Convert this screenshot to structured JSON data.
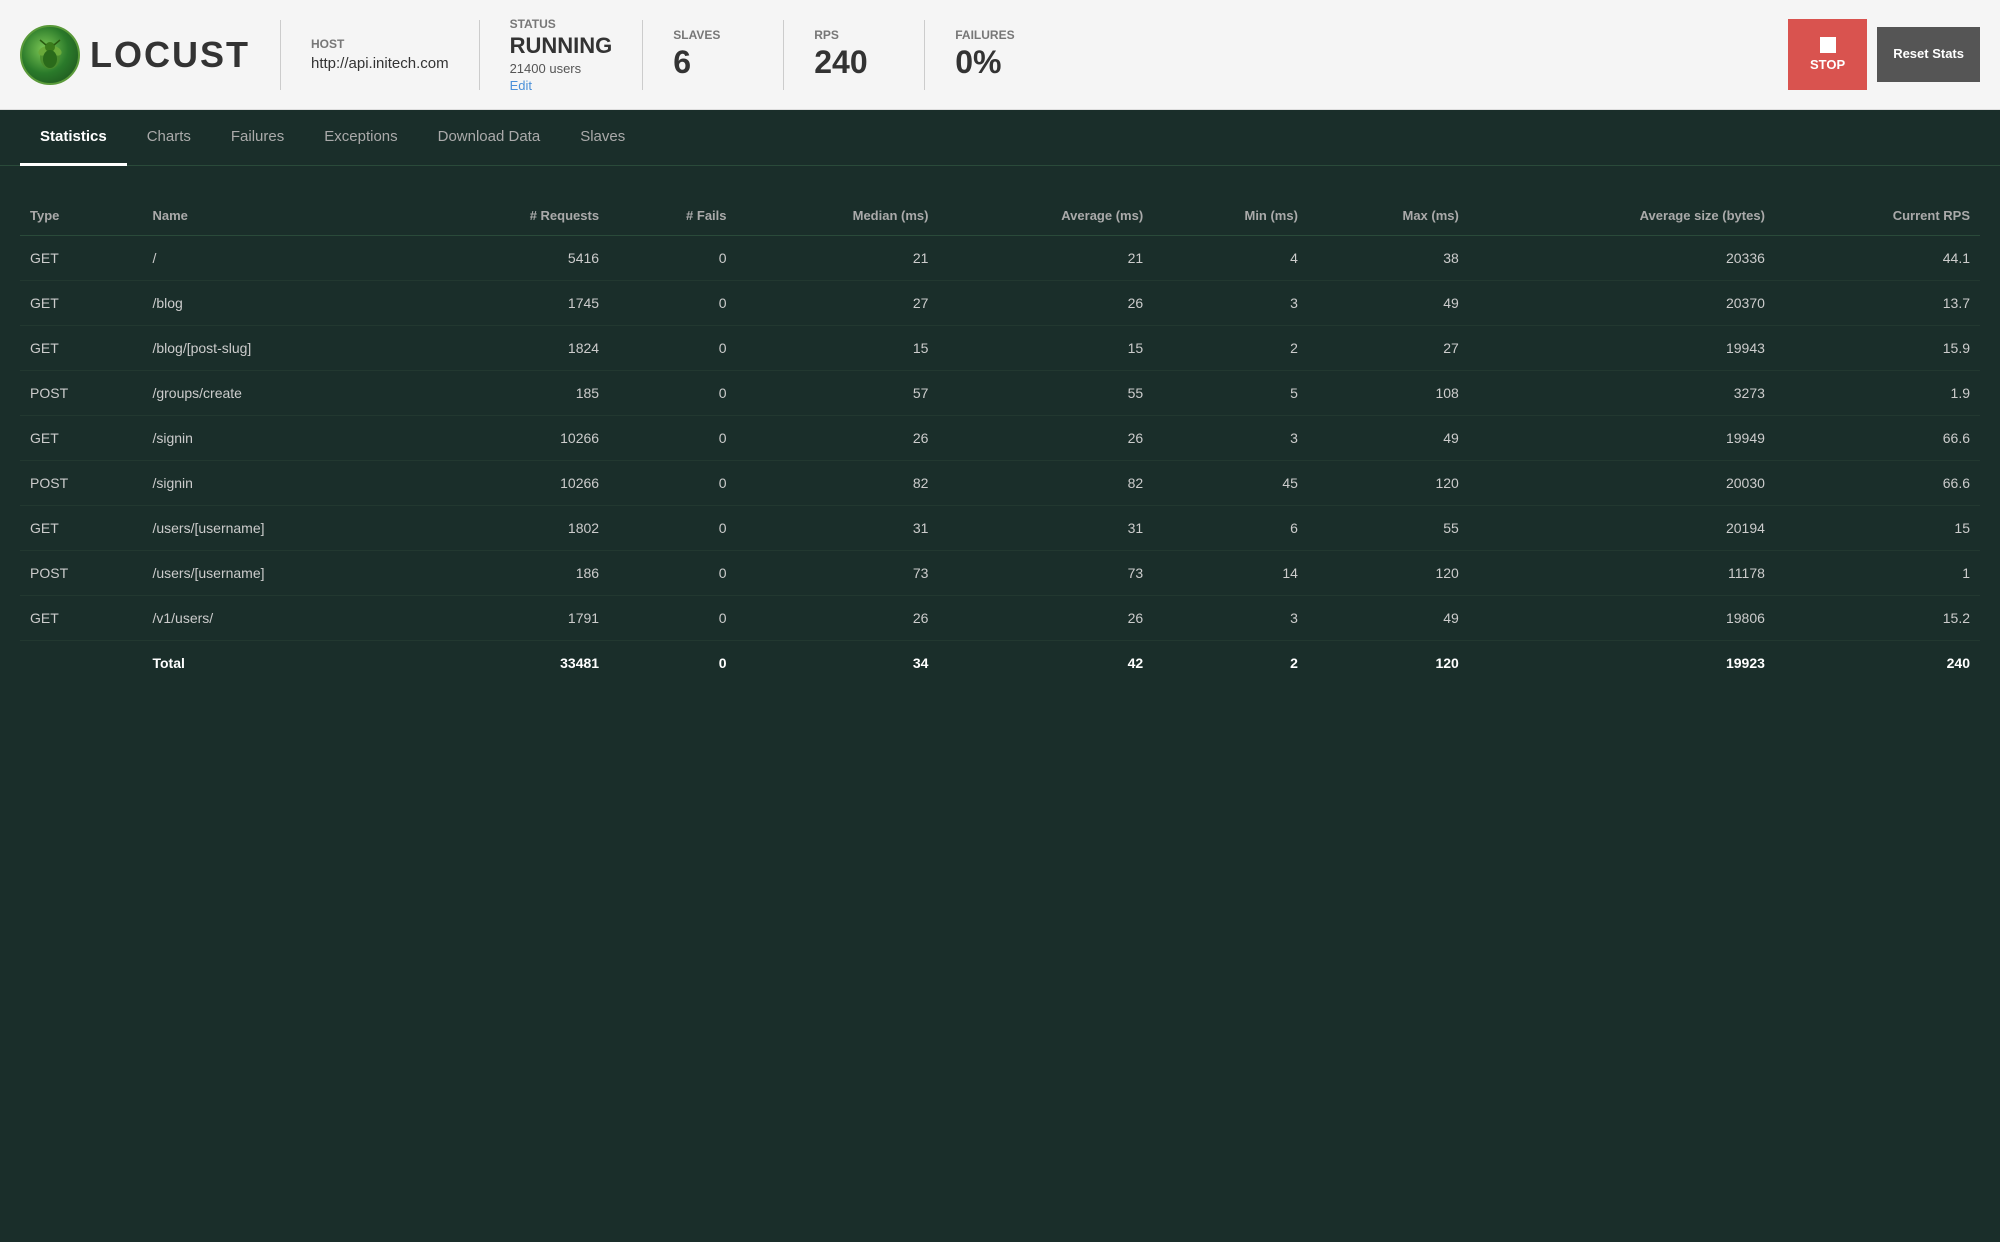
{
  "header": {
    "host_label": "HOST",
    "host_value": "http://api.initech.com",
    "status_label": "STATUS",
    "status_value": "RUNNING",
    "users": "21400 users",
    "edit_label": "Edit",
    "slaves_label": "SLAVES",
    "slaves_value": "6",
    "rps_label": "RPS",
    "rps_value": "240",
    "failures_label": "FAILURES",
    "failures_value": "0%",
    "stop_label": "STOP",
    "reset_label": "Reset Stats",
    "logo_text": "LOCUST"
  },
  "nav": {
    "tabs": [
      {
        "label": "Statistics",
        "active": true
      },
      {
        "label": "Charts",
        "active": false
      },
      {
        "label": "Failures",
        "active": false
      },
      {
        "label": "Exceptions",
        "active": false
      },
      {
        "label": "Download Data",
        "active": false
      },
      {
        "label": "Slaves",
        "active": false
      }
    ]
  },
  "table": {
    "columns": [
      "Type",
      "Name",
      "# Requests",
      "# Fails",
      "Median (ms)",
      "Average (ms)",
      "Min (ms)",
      "Max (ms)",
      "Average size (bytes)",
      "Current RPS"
    ],
    "rows": [
      {
        "type": "GET",
        "name": "/",
        "requests": "5416",
        "fails": "0",
        "median": "21",
        "average": "21",
        "min": "4",
        "max": "38",
        "avg_size": "20336",
        "rps": "44.1"
      },
      {
        "type": "GET",
        "name": "/blog",
        "requests": "1745",
        "fails": "0",
        "median": "27",
        "average": "26",
        "min": "3",
        "max": "49",
        "avg_size": "20370",
        "rps": "13.7"
      },
      {
        "type": "GET",
        "name": "/blog/[post-slug]",
        "requests": "1824",
        "fails": "0",
        "median": "15",
        "average": "15",
        "min": "2",
        "max": "27",
        "avg_size": "19943",
        "rps": "15.9"
      },
      {
        "type": "POST",
        "name": "/groups/create",
        "requests": "185",
        "fails": "0",
        "median": "57",
        "average": "55",
        "min": "5",
        "max": "108",
        "avg_size": "3273",
        "rps": "1.9"
      },
      {
        "type": "GET",
        "name": "/signin",
        "requests": "10266",
        "fails": "0",
        "median": "26",
        "average": "26",
        "min": "3",
        "max": "49",
        "avg_size": "19949",
        "rps": "66.6"
      },
      {
        "type": "POST",
        "name": "/signin",
        "requests": "10266",
        "fails": "0",
        "median": "82",
        "average": "82",
        "min": "45",
        "max": "120",
        "avg_size": "20030",
        "rps": "66.6"
      },
      {
        "type": "GET",
        "name": "/users/[username]",
        "requests": "1802",
        "fails": "0",
        "median": "31",
        "average": "31",
        "min": "6",
        "max": "55",
        "avg_size": "20194",
        "rps": "15"
      },
      {
        "type": "POST",
        "name": "/users/[username]",
        "requests": "186",
        "fails": "0",
        "median": "73",
        "average": "73",
        "min": "14",
        "max": "120",
        "avg_size": "11178",
        "rps": "1"
      },
      {
        "type": "GET",
        "name": "/v1/users/",
        "requests": "1791",
        "fails": "0",
        "median": "26",
        "average": "26",
        "min": "3",
        "max": "49",
        "avg_size": "19806",
        "rps": "15.2"
      }
    ],
    "total": {
      "label": "Total",
      "requests": "33481",
      "fails": "0",
      "median": "34",
      "average": "42",
      "min": "2",
      "max": "120",
      "avg_size": "19923",
      "rps": "240"
    }
  }
}
